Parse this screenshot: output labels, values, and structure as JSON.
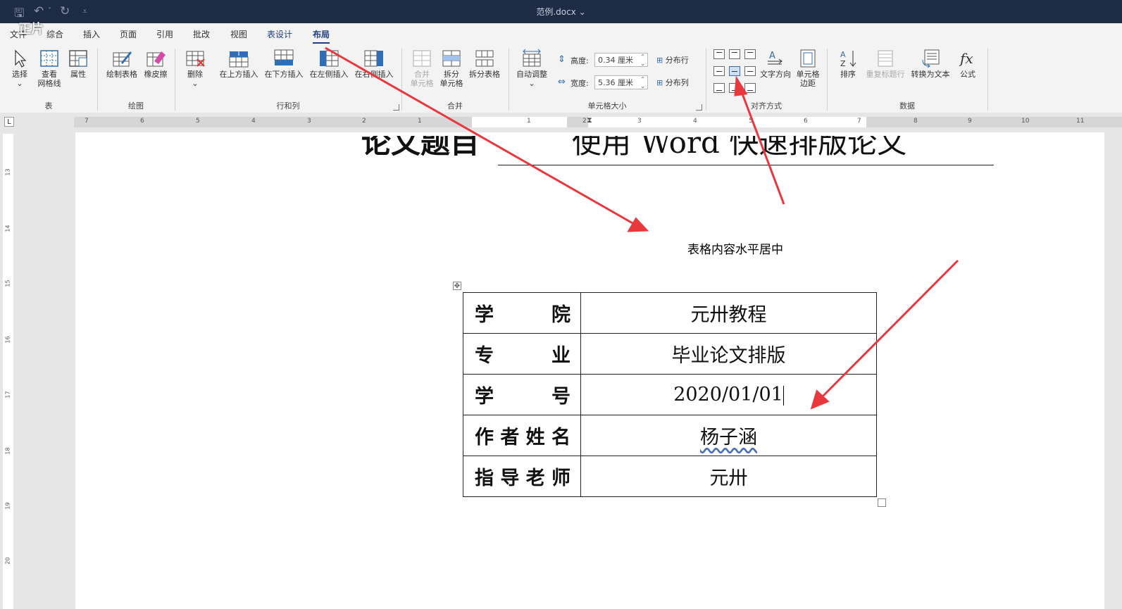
{
  "window": {
    "title": "范例.docx",
    "title_arrow": "⌄",
    "watermark": "正片"
  },
  "quick_access": {
    "save": "🖫",
    "undo": "↶",
    "undo_arrow": "˅",
    "redo": "↻",
    "customize": "⩡"
  },
  "tabs": [
    {
      "label": "文件"
    },
    {
      "label": "综合"
    },
    {
      "label": "插入"
    },
    {
      "label": "页面"
    },
    {
      "label": "引用"
    },
    {
      "label": "批改"
    },
    {
      "label": "视图"
    },
    {
      "label": "表设计"
    },
    {
      "label": "布局"
    }
  ],
  "ribbon": {
    "groups": {
      "table": "表",
      "draw": "绘图",
      "rows_cols": "行和列",
      "merge": "合并",
      "cell_size": "单元格大小",
      "alignment": "对齐方式",
      "data": "数据"
    },
    "buttons": {
      "select": "选择",
      "select_arrow": "⌄",
      "gridlines_1": "查看",
      "gridlines_2": "网格线",
      "properties": "属性",
      "draw_table": "绘制表格",
      "eraser": "橡皮擦",
      "delete": "删除",
      "delete_arrow": "⌄",
      "insert_above": "在上方插入",
      "insert_below": "在下方插入",
      "insert_left": "在左侧插入",
      "insert_right": "在右侧插入",
      "merge_1": "合并",
      "merge_2": "单元格",
      "split_1": "拆分",
      "split_2": "单元格",
      "split_table": "拆分表格",
      "autofit": "自动调整",
      "autofit_arrow": "⌄",
      "height_label": "高度:",
      "height_value": "0.34 厘米",
      "width_label": "宽度:",
      "width_value": "5.36 厘米",
      "distribute_rows": "分布行",
      "distribute_cols": "分布列",
      "text_direction": "文字方向",
      "cell_margins_1": "单元格",
      "cell_margins_2": "边距",
      "sort": "排序",
      "repeat_header": "重复标题行",
      "convert_text": "转换为文本",
      "formula": "公式"
    }
  },
  "ruler": {
    "h_numbers": [
      "7",
      "6",
      "5",
      "4",
      "3",
      "2",
      "1",
      "1",
      "2",
      "3",
      "4",
      "5",
      "6",
      "7",
      "8",
      "9",
      "10",
      "11"
    ],
    "v_numbers": [
      "13",
      "14",
      "15",
      "16",
      "17",
      "18",
      "19",
      "20"
    ]
  },
  "document": {
    "thesis_label": "论文题目",
    "thesis_title": "使用 Word 快速排版论文",
    "annotation": "表格内容水平居中",
    "table": [
      {
        "label_chars": [
          "学",
          "院"
        ],
        "value": "元卅教程"
      },
      {
        "label_chars": [
          "专",
          "业"
        ],
        "value": "毕业论文排版"
      },
      {
        "label_chars": [
          "学",
          "号"
        ],
        "value": "2020/01/01"
      },
      {
        "label_chars": [
          "作",
          "者",
          "姓",
          "名"
        ],
        "value": "杨子涵"
      },
      {
        "label_chars": [
          "指",
          "导",
          "老",
          "师"
        ],
        "value": "元卅"
      }
    ]
  },
  "colors": {
    "titlebar": "#1d2b45",
    "accent": "#1f3e7a",
    "annotation_arrow": "#e8383d"
  }
}
